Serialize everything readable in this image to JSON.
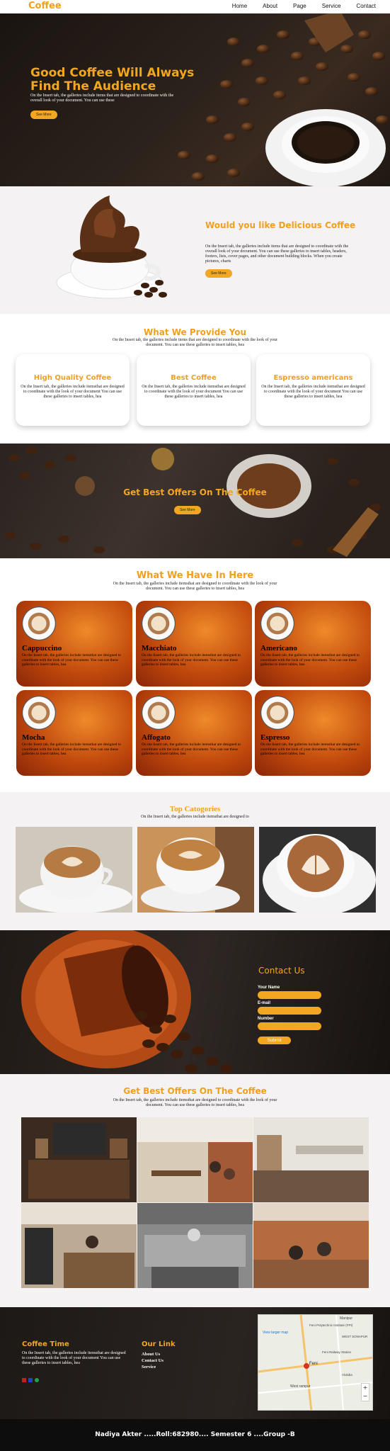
{
  "nav": {
    "logo": "Coffee",
    "items": [
      "Home",
      "About",
      "Page",
      "Service",
      "Contact"
    ]
  },
  "hero": {
    "title": "Good Coffee Will Always Find The Audience",
    "text": "On the Insert tab, the galleries include items that are designed to coordinate with the overall look of your document. You can use these",
    "button": "See More"
  },
  "about": {
    "title": "Would you like Delicious Coffee",
    "text": "On the Insert tab, the galleries include items that are designed to coordinate with the overall look of your document. You can use these galleries to insert tables, headers, footers, lists, cover pages, and other document building blocks. When you create pictures, charts",
    "button": "See More"
  },
  "provide": {
    "title": "What We Provide You",
    "subtitle": "On the Insert tab, the galleries include items that are designed to coordinate with the look of your document. You can use these galleries to insert tables, hea",
    "cards": [
      {
        "title": "High Quality Coffee",
        "text": "On the Insert tab, the galleries include itemsthat are designed to coordinate with the look of your document You can use these galleries to insert tables, hea"
      },
      {
        "title": "Best Coffee",
        "text": "On the Insert tab, the galleries include itemsthat are designed to coordinate with the look of your document You can use these galleries to insert tables, hea"
      },
      {
        "title": "Espresso americans",
        "text": "On the Insert tab, the galleries include itemsthat are designed to coordinate with the look of your document You can use these galleries to insert tables, hea"
      }
    ]
  },
  "offer": {
    "title": "Get Best Offers On The Coffee",
    "button": "See More"
  },
  "have": {
    "title": "What We Have In Here",
    "subtitle": "On the Insert tab, the galleries include itemsthat are designed to coordinate with the look of your document. You can use these galleries to insert tables, hea",
    "items": [
      {
        "name": "Cappuccino",
        "text": "On the Insert tab, the galleries include itemsthat are designed to coordinate with the look of your document. You can use these galleries to insert tables, hea"
      },
      {
        "name": "Macchiato",
        "text": "On the Insert tab, the galleries include itemsthat are designed to coordinate with the look of your document. You can use these galleries to insert tables, hea"
      },
      {
        "name": "Americano",
        "text": "On the Insert tab, the galleries include itemsthat are designed to coordinate with the look of your document. You can use these galleries to insert tables, hea"
      },
      {
        "name": "Mocha",
        "text": "On the Insert tab, the galleries include itemsthat are designed to coordinate with the look of your document. You can use these galleries to insert tables, hea"
      },
      {
        "name": "Affogato",
        "text": "On the Insert tab, the galleries include itemsthat are designed to coordinate with the look of your document. You can use these galleries to insert tables, hea"
      },
      {
        "name": "Espresso",
        "text": "On the Insert tab, the galleries include itemsthat are designed to coordinate with the look of your document. You can use these galleries to insert tables, hea"
      }
    ]
  },
  "cats": {
    "title": "Top Catogories",
    "subtitle": "On the Insert tab, the galleries include itemsthat are designed to"
  },
  "contact": {
    "title": "Contact Us",
    "name_label": "Your Name",
    "email_label": "E-mail",
    "number_label": "Number",
    "submit": "Submit"
  },
  "offer2": {
    "title": "Get Best Offers On The Coffee",
    "subtitle": "On the Insert tab, the galleries include itemsthat are designed to coordinate with the look of your document. You can use these galleries to insert tables, hea"
  },
  "footer": {
    "title": "Coffee Time",
    "text": "On the Insert tab, the galleries include itemsthat are designed to coordinate with the look of your document You can use these galleries to insert tables, hea",
    "links_title": "Our Link",
    "links": [
      "About Us",
      "Contact Us",
      "Service"
    ],
    "map_link": "View larger map",
    "map_labels": [
      "Manipur",
      "Feni Polytechnic Institute (FPI)",
      "WEST SONAPUR",
      "Feni Railway Station",
      "Feni",
      "Alokdia",
      "West rampur"
    ],
    "copyright": "Nadiya Akter .....Roll:682980.... Semester 6 ....Group -B"
  },
  "colors": {
    "accent": "#f3a61f",
    "dark": "#1d1917"
  }
}
